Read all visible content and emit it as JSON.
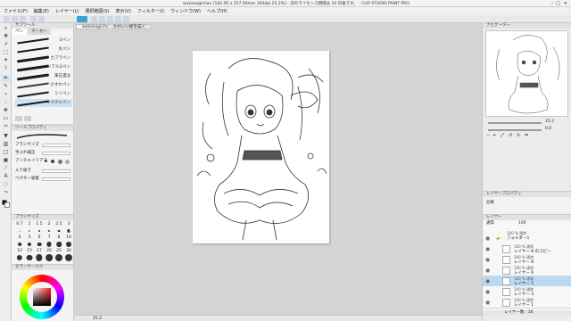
{
  "window": {
    "title": "wakaeagichan [182.00 x 257.00mm 350dpi 25.2%]  - 次のライセンス期限は 24 日後です。 - CLIP STUDIO PAINT PRO"
  },
  "menu": {
    "items": [
      "ファイル(F)",
      "編集(E)",
      "レイヤー(L)",
      "選択範囲(S)",
      "表示(V)",
      "フィルター(I)",
      "ウィンドウ(W)",
      "ヘルプ(H)"
    ]
  },
  "doc_tabs": [
    "wakaeagichan",
    "かわいい絵を描く"
  ],
  "subtool": {
    "header": "サブツール",
    "tabs": [
      "ペン",
      "マーカー"
    ],
    "brushes": [
      {
        "label": "Gペン"
      },
      {
        "label": "丸ペン"
      },
      {
        "label": "カブラペン"
      },
      {
        "label": "リアルGペン"
      },
      {
        "label": "筆圧濃淡"
      },
      {
        "label": "かすれペン"
      },
      {
        "label": "ミリペン"
      },
      {
        "label": "ネクタルペン"
      }
    ],
    "selected_index": 7
  },
  "toolprop": {
    "header": "ツールプロパティ",
    "rows": [
      "ブラシサイズ",
      "手ぶれ補正",
      "アンチエイリアス",
      "入り抜き",
      "ベクター吸着"
    ],
    "aa_label": "アンチエイリアス",
    "checkbox_label": "入り抜き"
  },
  "brushsize": {
    "header": "ブラシサイズ",
    "sizes": [
      "0.7",
      "1",
      "1.5",
      "2",
      "2.5",
      "3",
      "4",
      "5",
      "6",
      "7",
      "8",
      "10",
      "12",
      "15",
      "17",
      "20",
      "25",
      "30"
    ]
  },
  "color": {
    "header": "カラーサークル",
    "main_color": "#ff1e1e"
  },
  "navigator": {
    "header": "ナビゲーター",
    "zoom_value": "25.2",
    "rotate_value": "0.0"
  },
  "layerprop": {
    "header": "レイヤープロパティ",
    "effect_label": "効果"
  },
  "layers": {
    "header": "レイヤー",
    "blend_mode": "通常",
    "opacity": "100",
    "items": [
      {
        "opacity": "100 %  通常",
        "name": "フォルダー1",
        "folder": true
      },
      {
        "opacity": "100 %  通常",
        "name": "レイヤー 8 のコピー",
        "folder": false
      },
      {
        "opacity": "100 %  通常",
        "name": "レイヤー 8",
        "folder": false
      },
      {
        "opacity": "100 %  通常",
        "name": "レイヤー 6",
        "folder": false
      },
      {
        "opacity": "100 %  通常",
        "name": "レイヤー 5",
        "folder": false
      },
      {
        "opacity": "100 %  通常",
        "name": "レイヤー 3",
        "folder": false
      },
      {
        "opacity": "100 %  通常",
        "name": "レイヤー 1",
        "folder": false
      }
    ],
    "selected_index": 4,
    "status": "レイヤー数 : 10"
  },
  "statusbar": {
    "zoom": "25.2"
  }
}
